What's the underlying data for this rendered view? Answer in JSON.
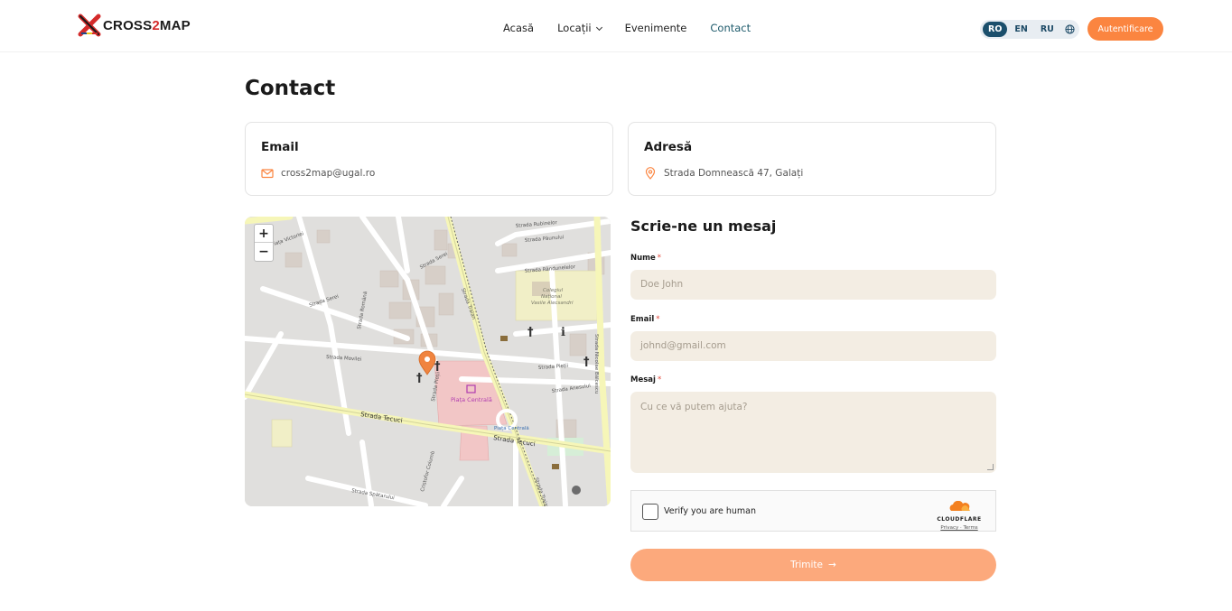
{
  "header": {
    "logo_text_a": "CROSS",
    "logo_text_b": "2",
    "logo_text_c": "MAP",
    "nav": [
      {
        "label": "Acasă"
      },
      {
        "label": "Locații"
      },
      {
        "label": "Evenimente"
      },
      {
        "label": "Contact"
      }
    ],
    "languages": [
      "RO",
      "EN",
      "RU"
    ],
    "active_language": "RO",
    "login_label": "Autentificare"
  },
  "page": {
    "title": "Contact"
  },
  "cards": {
    "email_title": "Email",
    "email_value": "cross2map@ugal.ro",
    "address_title": "Adresă",
    "address_value": "Strada Domnească 47, Galați"
  },
  "map": {
    "zoom_in": "+",
    "zoom_out": "−",
    "labels": {
      "piata_victoriei": "Piața Victoriei",
      "strada_rubinelor": "Strada Rubinelor",
      "strada_paunului": "Strada Păunului",
      "strada_randunelelor": "Strada Rândunelelor",
      "strada_serei": "Strada Serei",
      "strada_romana": "Strada Română",
      "strada_movilei": "Strada Movilei",
      "strada_tecuci": "Strada Tecuci",
      "strada_traian": "Strada Traian",
      "strada_pietii": "Strada Pieții",
      "strada_anesului": "Strada Anesului",
      "strada_spatarului": "Strada Spătarului",
      "colegiul_1": "Colegiul",
      "colegiul_2": "Național",
      "colegiul_3": "Vasile Alecsandri",
      "piata_centrala": "Piața Centrală",
      "piata_centrala_2": "Piața Centrală",
      "strada_balcescu": "Strada Nicolae Bălcescu",
      "cristofor": "Cristofor Columb"
    }
  },
  "form": {
    "title": "Scrie-ne un mesaj",
    "name_label": "Nume",
    "name_placeholder": "Doe John",
    "email_label": "Email",
    "email_placeholder": "johnd@gmail.com",
    "message_label": "Mesaj",
    "message_placeholder": "Cu ce vă putem ajuta?",
    "required_mark": "*",
    "captcha_text": "Verify you are human",
    "captcha_brand": "CLOUDFLARE",
    "captcha_links": "Privacy · Terms",
    "submit_label": "Trimite",
    "submit_arrow": "→"
  },
  "colors": {
    "accent": "#fb8540",
    "submit_disabled": "#fca97c",
    "field_bg": "#f3ede3",
    "nav_active": "#1d5a6b"
  }
}
